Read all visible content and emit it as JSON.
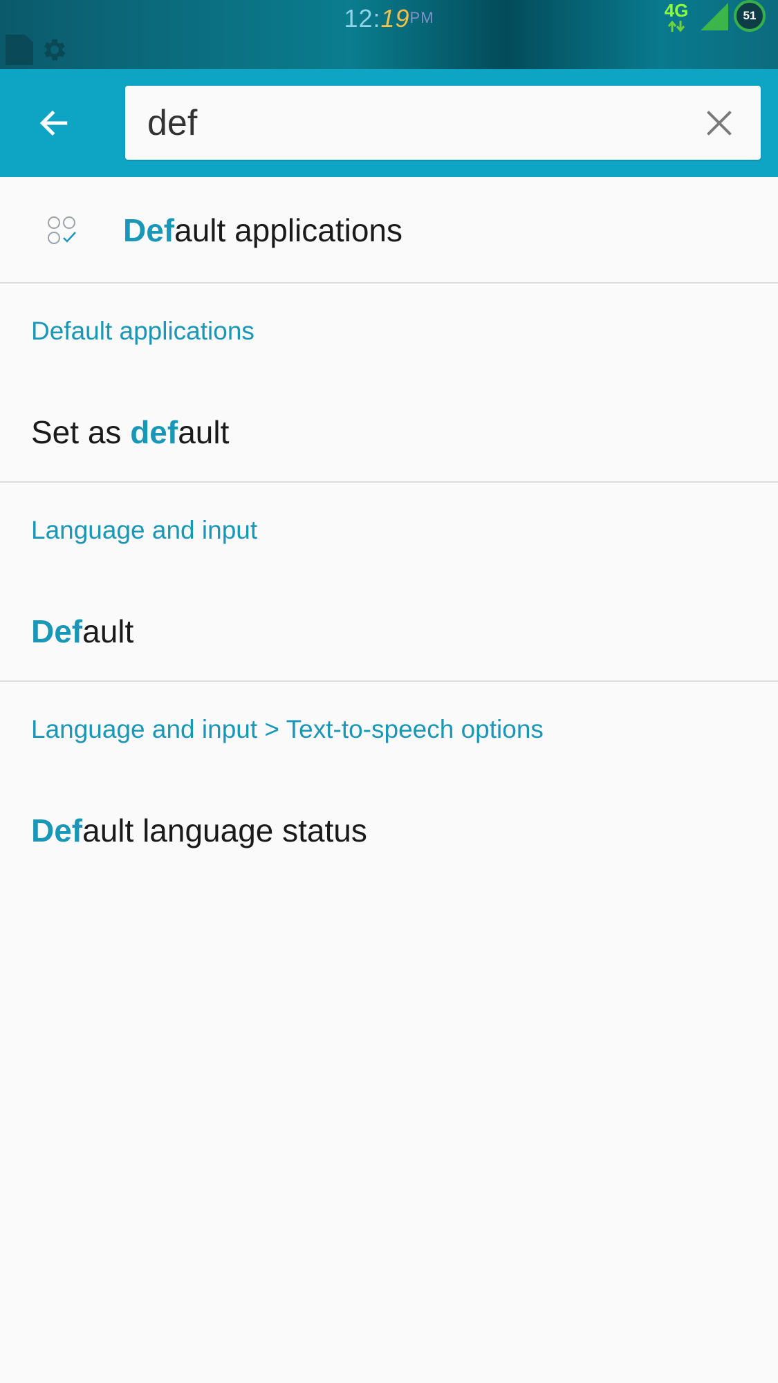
{
  "status_bar": {
    "clock_hour": "12",
    "clock_sep": ":",
    "clock_minute": "19",
    "clock_ampm": "PM",
    "network_type": "4G",
    "battery_level": "51",
    "icons": [
      "file-icon",
      "gear-icon",
      "data-arrows-icon",
      "signal-icon",
      "battery-icon"
    ]
  },
  "app_bar": {
    "back_icon": "arrow-left-icon",
    "search_value": "def",
    "clear_icon": "close-icon"
  },
  "results": {
    "top": {
      "icon": "default-apps-icon",
      "match": "Def",
      "rest": "ault applications"
    },
    "items": [
      {
        "category": "Default applications",
        "prefix": "Set as ",
        "match": "def",
        "rest": "ault"
      },
      {
        "category": "Language and input",
        "prefix": "",
        "match": "Def",
        "rest": "ault"
      },
      {
        "category": "Language and input > Text-to-speech options",
        "prefix": "",
        "match": "Def",
        "rest": "ault language status"
      }
    ]
  },
  "colors": {
    "app_bar": "#0ea5c4",
    "accent": "#1a97b7",
    "background": "#fafafa",
    "divider": "#dcdcdc"
  }
}
